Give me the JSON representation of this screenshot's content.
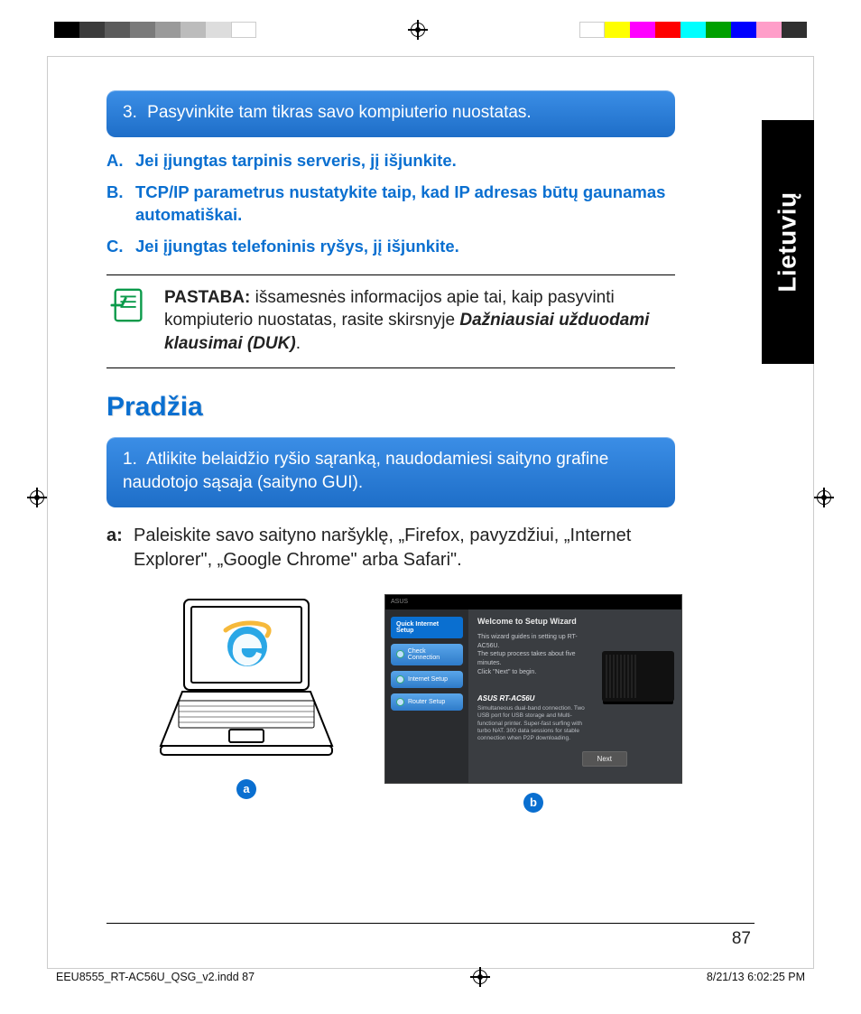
{
  "language_tab": "Lietuvių",
  "step3": {
    "num": "3.",
    "text": "Pasyvinkite tam tikras savo kompiuterio nuostatas."
  },
  "subA": {
    "label": "A.",
    "text": "Jei įjungtas tarpinis serveris, jį išjunkite."
  },
  "subB": {
    "label": "B.",
    "text": "TCP/IP parametrus nustatykite taip, kad IP adresas būtų gaunamas automatiškai."
  },
  "subC": {
    "label": "C.",
    "text": "Jei įjungtas telefoninis ryšys, jį išjunkite."
  },
  "note": {
    "lead": "PASTABA:",
    "body": "išsamesnės informacijos apie tai, kaip pasyvinti kompiuterio nuostatas, rasite skirsnyje ",
    "emph": "Dažniausiai užduodami klausimai (DUK)",
    "tail": "."
  },
  "section_title": "Pradžia",
  "step1": {
    "num": "1.",
    "text": "Atlikite belaidžio ryšio sąranką, naudodamiesi saityno grafine naudotojo sąsaja (saityno GUI)."
  },
  "body_a": {
    "k": "a:",
    "text": "Paleiskite savo saityno naršyklę, „Firefox, pavyzdžiui, „Internet Explorer\", „Google Chrome\" arba Safari\"."
  },
  "figA_badge": "a",
  "figB_badge": "b",
  "wizard": {
    "brand": "ASUS",
    "side_top": "Quick Internet Setup",
    "side1": "Check Connection",
    "side2": "Internet Setup",
    "side3": "Router Setup",
    "title": "Welcome to Setup Wizard",
    "line1": "This wizard guides in setting up RT-AC56U.",
    "line2": "The setup process takes about five minutes.",
    "line3": "Click \"Next\" to begin.",
    "model_label": "ASUS RT-AC56U",
    "desc": "Simultaneous dual-band connection. Two USB port for USB storage and Multi-functional printer. Super-fast surfing with turbo NAT. 300 data sessions for stable connection when P2P downloading.",
    "next": "Next"
  },
  "page_number": "87",
  "imposition_file": "EEU8555_RT-AC56U_QSG_v2.indd   87",
  "imposition_time": "8/21/13   6:02:25 PM",
  "calib_left": [
    "#000000",
    "#3b3b3b",
    "#5b5b5b",
    "#7a7a7a",
    "#9a9a9a",
    "#bcbcbc",
    "#dddddd",
    "#ffffff"
  ],
  "calib_right": [
    "#ffffff",
    "#ffff00",
    "#ff00ff",
    "#ff0000",
    "#00ffff",
    "#00a000",
    "#0000ff",
    "#ff9ec9",
    "#303030"
  ]
}
